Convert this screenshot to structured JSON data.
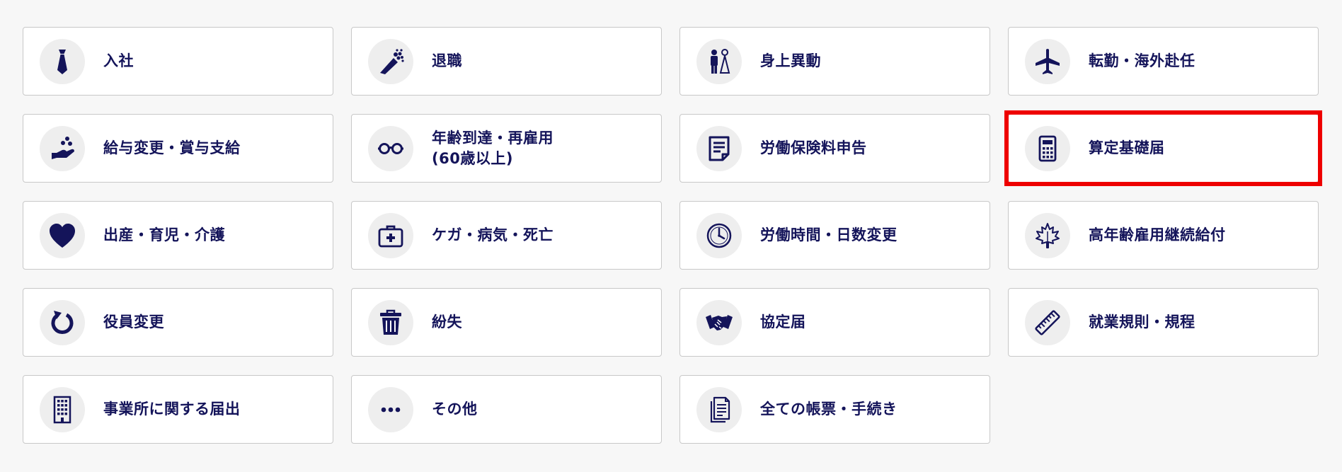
{
  "accent_color": "#14145a",
  "highlight_color": "#ee0000",
  "items": [
    {
      "label": "入社",
      "icon": "necktie-icon"
    },
    {
      "label": "退職",
      "icon": "bouquet-icon"
    },
    {
      "label": "身上異動",
      "icon": "couple-icon"
    },
    {
      "label": "転勤・海外赴任",
      "icon": "airplane-icon"
    },
    {
      "label": "給与変更・賞与支給",
      "icon": "hand-coins-icon"
    },
    {
      "label": "年齢到達・再雇用\n(60歳以上)",
      "icon": "glasses-icon"
    },
    {
      "label": "労働保険料申告",
      "icon": "document-icon"
    },
    {
      "label": "算定基礎届",
      "icon": "calculator-icon",
      "highlighted": true
    },
    {
      "label": "出産・育児・介護",
      "icon": "heart-icon"
    },
    {
      "label": "ケガ・病気・死亡",
      "icon": "first-aid-kit-icon"
    },
    {
      "label": "労働時間・日数変更",
      "icon": "clock-icon"
    },
    {
      "label": "高年齢雇用継続給付",
      "icon": "maple-leaf-icon"
    },
    {
      "label": "役員変更",
      "icon": "refresh-icon"
    },
    {
      "label": "紛失",
      "icon": "trash-icon"
    },
    {
      "label": "協定届",
      "icon": "handshake-icon"
    },
    {
      "label": "就業規則・規程",
      "icon": "ruler-icon"
    },
    {
      "label": "事業所に関する届出",
      "icon": "building-icon"
    },
    {
      "label": "その他",
      "icon": "more-icon"
    },
    {
      "label": "全ての帳票・手続き",
      "icon": "documents-icon"
    }
  ]
}
